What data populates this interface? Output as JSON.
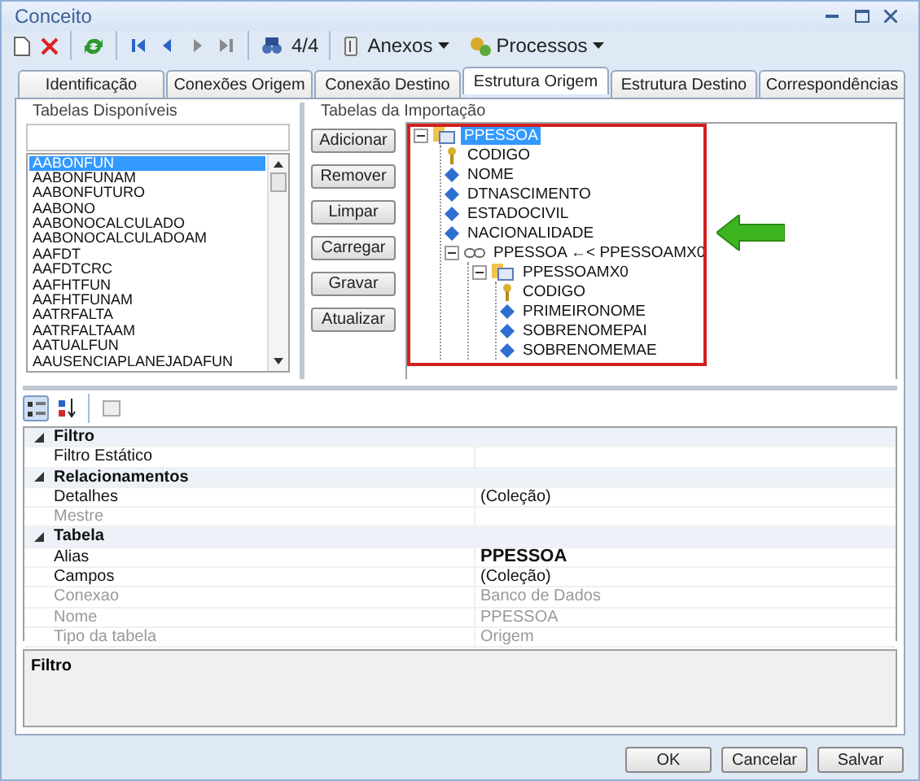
{
  "window": {
    "title": "Conceito"
  },
  "toolbar": {
    "nav_buttons": [
      {
        "kind": "first",
        "disabled": false
      },
      {
        "kind": "prev",
        "disabled": false
      },
      {
        "kind": "next",
        "disabled": true
      },
      {
        "kind": "last",
        "disabled": true
      }
    ],
    "record_counter": "4/4",
    "menus": [
      {
        "kind": "attach",
        "label": "Anexos"
      },
      {
        "kind": "process",
        "label": "Processos"
      }
    ]
  },
  "tabs": [
    {
      "label": "Identificação",
      "selected": false
    },
    {
      "label": "Conexões Origem",
      "selected": false
    },
    {
      "label": "Conexão Destino",
      "selected": false
    },
    {
      "label": "Estrutura Origem",
      "selected": true
    },
    {
      "label": "Estrutura Destino",
      "selected": false
    },
    {
      "label": "Correspondências",
      "selected": false
    }
  ],
  "available_tables": {
    "title": "Tabelas Disponíveis",
    "items": [
      {
        "label": "AABONFUN",
        "selected": true
      },
      {
        "label": "AABONFUNAM",
        "selected": false
      },
      {
        "label": "AABONFUTURO",
        "selected": false
      },
      {
        "label": "AABONO",
        "selected": false
      },
      {
        "label": "AABONOCALCULADO",
        "selected": false
      },
      {
        "label": "AABONOCALCULADOAM",
        "selected": false
      },
      {
        "label": "AAFDT",
        "selected": false
      },
      {
        "label": "AAFDTCRC",
        "selected": false
      },
      {
        "label": "AAFHTFUN",
        "selected": false
      },
      {
        "label": "AAFHTFUNAM",
        "selected": false
      },
      {
        "label": "AATRFALTA",
        "selected": false
      },
      {
        "label": "AATRFALTAAM",
        "selected": false
      },
      {
        "label": "AATUALFUN",
        "selected": false
      },
      {
        "label": "AAUSENCIAPLANEJADAFUN",
        "selected": false
      }
    ]
  },
  "action_buttons": [
    "Adicionar",
    "Remover",
    "Limpar",
    "Carregar",
    "Gravar",
    "Atualizar"
  ],
  "import_tables": {
    "title": "Tabelas da Importação",
    "tree": [
      {
        "label": "PPESSOA",
        "kind": "table",
        "selected": true,
        "expanded": true,
        "children": [
          {
            "label": "CODIGO",
            "kind": "key",
            "selected": false
          },
          {
            "label": "NOME",
            "kind": "field",
            "selected": false
          },
          {
            "label": "DTNASCIMENTO",
            "kind": "field",
            "selected": false
          },
          {
            "label": "ESTADOCIVIL",
            "kind": "field",
            "selected": false
          },
          {
            "label": "NACIONALIDADE",
            "kind": "field",
            "selected": false
          },
          {
            "label": "PPESSOA ←< PPESSOAMX0",
            "kind": "relation",
            "selected": false,
            "expanded": true,
            "children": [
              {
                "label": "PPESSOAMX0",
                "kind": "table",
                "selected": false,
                "expanded": true,
                "children": [
                  {
                    "label": "CODIGO",
                    "kind": "key",
                    "selected": false
                  },
                  {
                    "label": "PRIMEIRONOME",
                    "kind": "field",
                    "selected": false
                  },
                  {
                    "label": "SOBRENOMEPAI",
                    "kind": "field",
                    "selected": false
                  },
                  {
                    "label": "SOBRENOMEMAE",
                    "kind": "field",
                    "selected": false
                  }
                ]
              }
            ]
          }
        ]
      }
    ]
  },
  "property_grid": {
    "sort_modes": [
      {
        "kind": "categorized",
        "selected": true
      },
      {
        "kind": "alphabetical",
        "selected": false
      }
    ],
    "rows": [
      {
        "kind": "category",
        "name": "Filtro",
        "expanded": true
      },
      {
        "kind": "property",
        "name": "Filtro Estático",
        "readonly": false
      },
      {
        "kind": "category",
        "name": "Relacionamentos",
        "expanded": true
      },
      {
        "kind": "property",
        "name": "Detalhes",
        "value": "(Coleção)",
        "readonly": false
      },
      {
        "kind": "property",
        "name": "Mestre",
        "readonly": true
      },
      {
        "kind": "category",
        "name": "Tabela",
        "expanded": true
      },
      {
        "kind": "property",
        "name": "Alias",
        "value": "PPESSOA",
        "readonly": false,
        "modified": true
      },
      {
        "kind": "property",
        "name": "Campos",
        "value": "(Coleção)",
        "readonly": false
      },
      {
        "kind": "property",
        "name": "Conexao",
        "value": "Banco de Dados",
        "readonly": true
      },
      {
        "kind": "property",
        "name": "Nome",
        "value": "PPESSOA",
        "readonly": true
      },
      {
        "kind": "property",
        "name": "Tipo da tabela",
        "value": "Origem",
        "readonly": true
      }
    ],
    "description_title": "Filtro"
  },
  "footer_buttons": [
    "OK",
    "Cancelar",
    "Salvar"
  ]
}
